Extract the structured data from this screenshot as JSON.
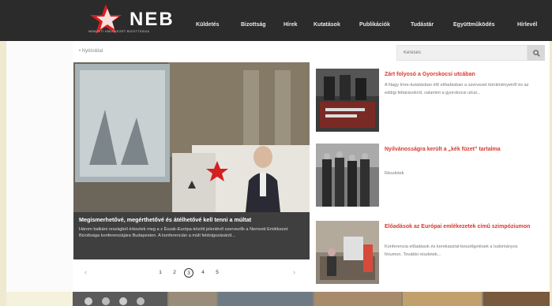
{
  "header": {
    "logo_text": "NEB",
    "logo_subtitle": "NEMZETI EMLÉKEZET BIZOTTSÁGA",
    "nav": [
      "Küldetés",
      "Bizottság",
      "Hírek",
      "Kutatások",
      "Publikációk",
      "Tudástár",
      "Együttműködés",
      "Hírlevél"
    ]
  },
  "breadcrumb": "• Nyitóoldal",
  "search": {
    "placeholder": "Keresés"
  },
  "hero": {
    "title": "Megismerhetővé, megérthetővé és átélhetővé kell tenni a múltat",
    "text": "Három balkáni országból érkeztek meg a z Észak-Európa-között jelenlévő szervezők a Nemzeti Emlékezet Bizottsága konferenciájára Budapesten. A konferencián a múlt feldolgozásáról..."
  },
  "pager": {
    "pages": [
      "1",
      "2",
      "3",
      "4",
      "5"
    ],
    "active_index": 2
  },
  "articles": [
    {
      "title": "Zárt folyosó a Gyorskocsi utcában",
      "excerpt": "A Nagy Imre-kutatásban élő előadásban a szervezet körülményeiről és az eddigi feltárásokról, valamint a gyorskocsi utcai..."
    },
    {
      "title": "Nyilvánosságra került a „kék füzet” tartalma",
      "excerpt": "Részletek"
    },
    {
      "title": "Előadások az Európai emlékezetek című szimpóziumon",
      "excerpt": "Konferencia előadások és kerekasztal-beszélgetések a tudományos fórumon. További részletek..."
    }
  ]
}
